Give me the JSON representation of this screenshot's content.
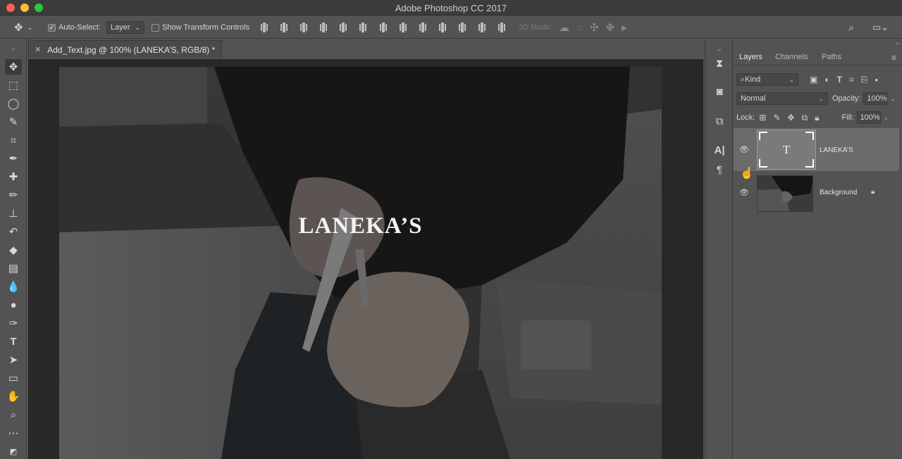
{
  "app": {
    "title": "Adobe Photoshop CC 2017"
  },
  "options_bar": {
    "move_icon": "move-tool-icon",
    "auto_select_label": "Auto-Select:",
    "auto_select_checked": true,
    "auto_select_value": "Layer",
    "show_transform_label": "Show Transform Controls",
    "show_transform_checked": false,
    "mode_3d_label": "3D Mode:"
  },
  "document": {
    "tab_title": "Add_Text.jpg @ 100% (LANEKA’S, RGB/8) *",
    "canvas_text": "LANEKA’S"
  },
  "tools": [
    "move-tool-icon",
    "marquee-tool-icon",
    "lasso-tool-icon",
    "quick-select-tool-icon",
    "crop-tool-icon",
    "eyedropper-tool-icon",
    "healing-brush-icon",
    "brush-tool-icon",
    "clone-stamp-icon",
    "history-brush-icon",
    "eraser-tool-icon",
    "gradient-tool-icon",
    "blur-tool-icon",
    "dodge-tool-icon",
    "pen-tool-icon",
    "type-tool-icon",
    "path-select-icon",
    "rectangle-tool-icon",
    "hand-tool-icon",
    "zoom-tool-icon",
    "more-tools-icon",
    "color-swatch-icon"
  ],
  "layers_panel": {
    "tabs": [
      "Layers",
      "Channels",
      "Paths"
    ],
    "active_tab": "Layers",
    "filter_label": "Kind",
    "blend_mode": "Normal",
    "opacity_label": "Opacity:",
    "opacity_value": "100%",
    "lock_label": "Lock:",
    "fill_label": "Fill:",
    "fill_value": "100%",
    "layers": [
      {
        "name": "LANEKA’S",
        "type": "text",
        "selected": true,
        "visible": true
      },
      {
        "name": "Background",
        "type": "image",
        "selected": false,
        "visible": true,
        "locked": true
      }
    ]
  }
}
